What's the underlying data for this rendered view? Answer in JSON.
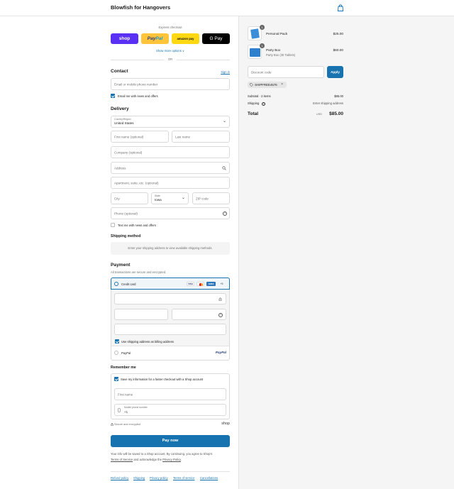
{
  "header": {
    "shop_name": "Blowfish for Hangovers",
    "cart_icon": "shopping-bag-icon"
  },
  "express": {
    "title": "Express checkout",
    "buttons": {
      "shop": "shop",
      "paypal_pay": "Pay",
      "paypal_pal": "Pal",
      "amazon": "amazon pay",
      "gpay": "G Pay"
    },
    "more": "Show more options ∨",
    "or": "OR"
  },
  "contact": {
    "title": "Contact",
    "sign_in": "Sign in",
    "email_placeholder": "Email or mobile phone number",
    "news_label": "Email me with news and offers"
  },
  "delivery": {
    "title": "Delivery",
    "country_label": "Country/Region",
    "country_value": "United States",
    "first_name": "First name (optional)",
    "last_name": "Last name",
    "company": "Company (optional)",
    "address": "Address",
    "apartment": "Apartment, suite, etc. (optional)",
    "city": "City",
    "state_label": "State",
    "state_value": "Iowa",
    "zip": "ZIP code",
    "phone": "Phone (optional)",
    "text_label": "Text me with news and offers"
  },
  "shipping_method": {
    "title": "Shipping method",
    "message": "Enter your shipping address to view available shipping methods."
  },
  "payment": {
    "title": "Payment",
    "subtitle": "All transactions are secure and encrypted.",
    "credit_card": "Credit card",
    "cards": [
      "VISA",
      "MC",
      "AMEX",
      "+5"
    ],
    "billing_label": "Use shipping address as billing address",
    "paypal": "PayPal",
    "paypal_logo": "PayPal"
  },
  "remember": {
    "title": "Remember me",
    "save_label": "Save my information for a faster checkout with a Shop account",
    "first_name": "First name",
    "phone_label": "Mobile phone number",
    "phone_value": "+1",
    "secure": "Secure and encrypted",
    "shop_logo": "shop"
  },
  "pay_button": "Pay now",
  "legal": {
    "line1": "Your info will be saved to a Shop account. By continuing, you agree to Shop's",
    "tos": "Terms of Service",
    "mid": " and acknowledge the ",
    "privacy": "Privacy Policy",
    "end": "."
  },
  "footer_links": [
    "Refund policy",
    "Shipping",
    "Privacy policy",
    "Terms of service",
    "Cancellations"
  ],
  "summary": {
    "items": [
      {
        "qty": "1",
        "name": "Personal Pack",
        "variant": "",
        "price": "$25.00"
      },
      {
        "qty": "1",
        "name": "Party Box",
        "variant": "Party Box (30 Tablets)",
        "price": "$60.00"
      }
    ],
    "discount_placeholder": "Discount code",
    "apply": "Apply",
    "discount_tag": "SHIPFREE4576",
    "subtotal_label": "Subtotal · 2 items",
    "subtotal_value": "$85.00",
    "shipping_label": "Shipping",
    "shipping_value": "Enter shipping address",
    "total_label": "Total",
    "currency": "USD",
    "total_value": "$85.00"
  },
  "colors": {
    "accent": "#1773b0",
    "shop_purple": "#5a31f4",
    "paypal_yellow": "#ffc439",
    "amazon_yellow": "#ffd814"
  }
}
